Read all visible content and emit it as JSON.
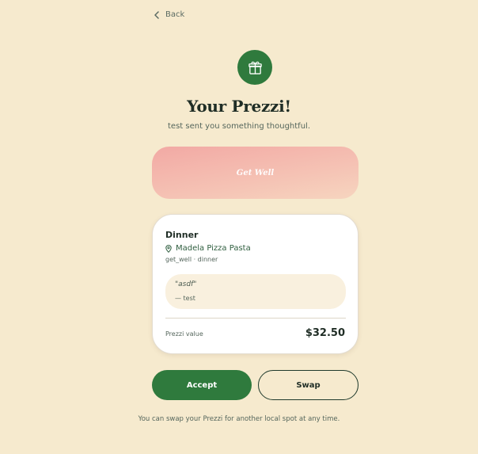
{
  "nav": {
    "back_label": "Back",
    "back_icon": "chevron-left-icon"
  },
  "header": {
    "icon": "gift-icon",
    "title": "Your Prezzi!",
    "subtitle": "test sent you something thoughtful."
  },
  "occasion": {
    "label": "Get Well"
  },
  "gift_card": {
    "title": "Dinner",
    "place_icon": "map-pin-icon",
    "place_name": "Madela Pizza Pasta",
    "tags": "get_well · dinner",
    "message": "\"asdf\"",
    "sender": "— test",
    "value_label": "Prezzi value",
    "value_amount": "$32.50"
  },
  "actions": {
    "accept_label": "Accept",
    "swap_label": "Swap"
  },
  "footnote": "You can swap your Prezzi for another local spot at any time.",
  "colors": {
    "background": "#f6eace",
    "brand_green": "#2f7a3d",
    "occasion_gradient_start": "#f2a9a4",
    "occasion_gradient_end": "#f6d5bf",
    "note_background": "#f9f0de"
  }
}
